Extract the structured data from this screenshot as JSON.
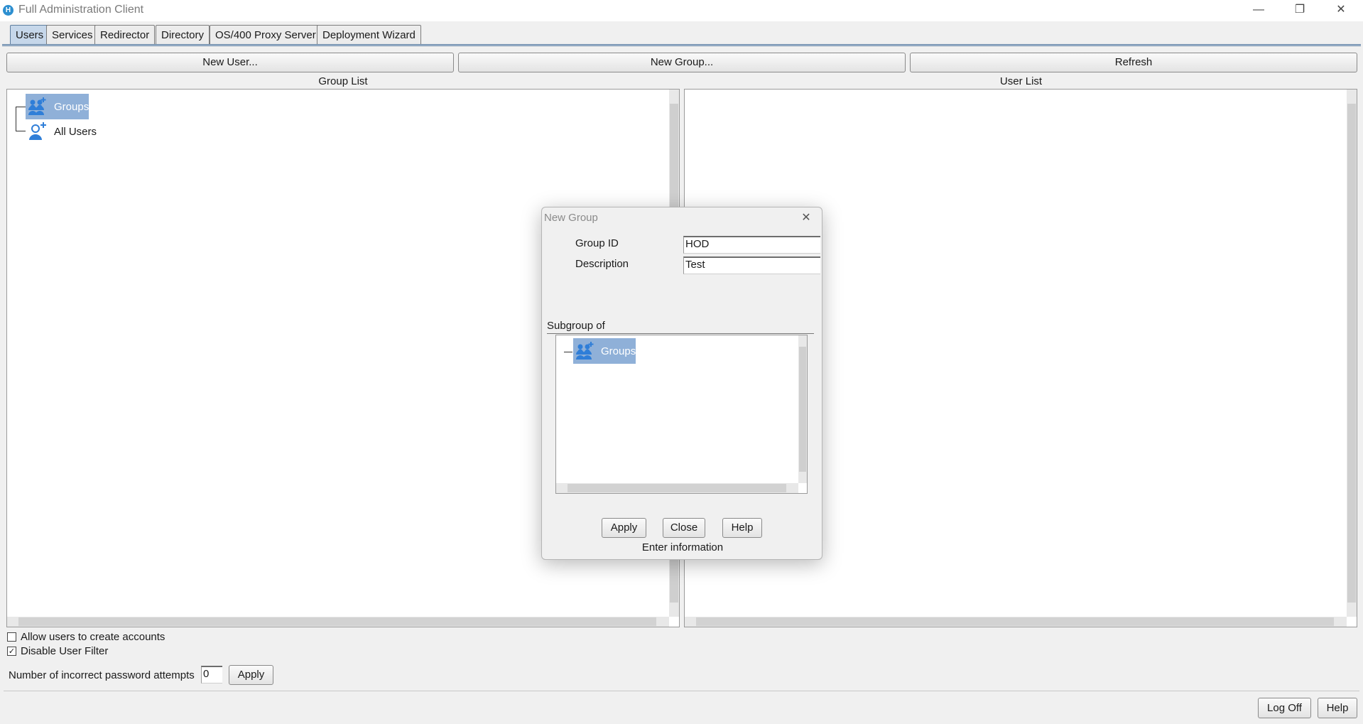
{
  "window": {
    "title": "Full Administration Client",
    "icon_letter": "H",
    "minimize": "—",
    "maximize": "❐",
    "close": "✕"
  },
  "tabs": [
    {
      "label": "Users",
      "active": true
    },
    {
      "label": "Services"
    },
    {
      "label": "Redirector"
    },
    {
      "label": "Directory"
    },
    {
      "label": "OS/400 Proxy Server"
    },
    {
      "label": "Deployment Wizard"
    }
  ],
  "toolbar": {
    "new_user": "New User...",
    "new_group": "New Group...",
    "refresh": "Refresh"
  },
  "group_list": {
    "heading": "Group List",
    "items": [
      {
        "label": "Groups",
        "icon": "group-icon",
        "selected": true
      },
      {
        "label": "All Users",
        "icon": "user-icon"
      }
    ]
  },
  "user_list": {
    "heading": "User List"
  },
  "options": {
    "allow_create": {
      "label": "Allow users to create accounts",
      "checked": false
    },
    "disable_filter": {
      "label": "Disable User Filter",
      "checked": true,
      "mark": "✓"
    },
    "password_attempts": {
      "label": "Number of incorrect password attempts",
      "value": "0",
      "apply": "Apply"
    }
  },
  "footer": {
    "log_off": "Log Off",
    "help": "Help"
  },
  "dialog": {
    "title": "New Group",
    "close_icon": "✕",
    "group_id_label": "Group ID",
    "group_id_value": "HOD",
    "description_label": "Description",
    "description_value": "Test",
    "subgroup_label": "Subgroup of",
    "subgroup_items": [
      {
        "label": "Groups",
        "icon": "group-icon",
        "selected": true
      }
    ],
    "apply": "Apply",
    "close": "Close",
    "help": "Help",
    "status": "Enter information"
  },
  "colors": {
    "accent_blue": "#2f7ed8",
    "selection": "#8fb0d8",
    "tab_active": "#c6d7ea"
  }
}
